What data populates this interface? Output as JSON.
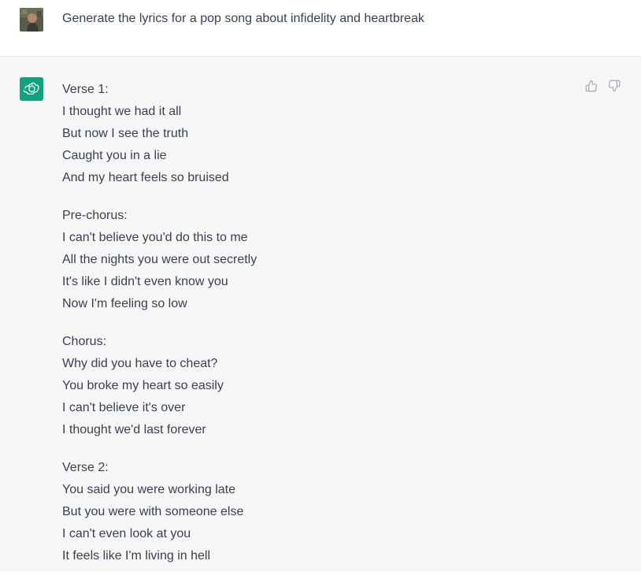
{
  "user_message": {
    "text": "Generate the lyrics for a pop song about infidelity and heartbreak",
    "avatar_icon": "user-photo-avatar"
  },
  "assistant_message": {
    "avatar_icon": "openai-logo-icon",
    "avatar_color": "#10a37f",
    "feedback": {
      "thumbs_up_icon": "thumbs-up-icon",
      "thumbs_down_icon": "thumbs-down-icon"
    },
    "stanzas": [
      {
        "label": "Verse 1:",
        "lines": [
          "I thought we had it all",
          "But now I see the truth",
          "Caught you in a lie",
          "And my heart feels so bruised"
        ]
      },
      {
        "label": "Pre-chorus:",
        "lines": [
          "I can't believe you'd do this to me",
          "All the nights you were out secretly",
          "It's like I didn't even know you",
          "Now I'm feeling so low"
        ]
      },
      {
        "label": "Chorus:",
        "lines": [
          "Why did you have to cheat?",
          "You broke my heart so easily",
          "I can't believe it's over",
          "I thought we'd last forever"
        ]
      },
      {
        "label": "Verse 2:",
        "lines": [
          "You said you were working late",
          "But you were with someone else",
          "I can't even look at you",
          "It feels like I'm living in hell"
        ]
      }
    ]
  },
  "colors": {
    "assistant_bg": "#f7f7f8",
    "text": "#374151",
    "icon": "#acacbe"
  }
}
